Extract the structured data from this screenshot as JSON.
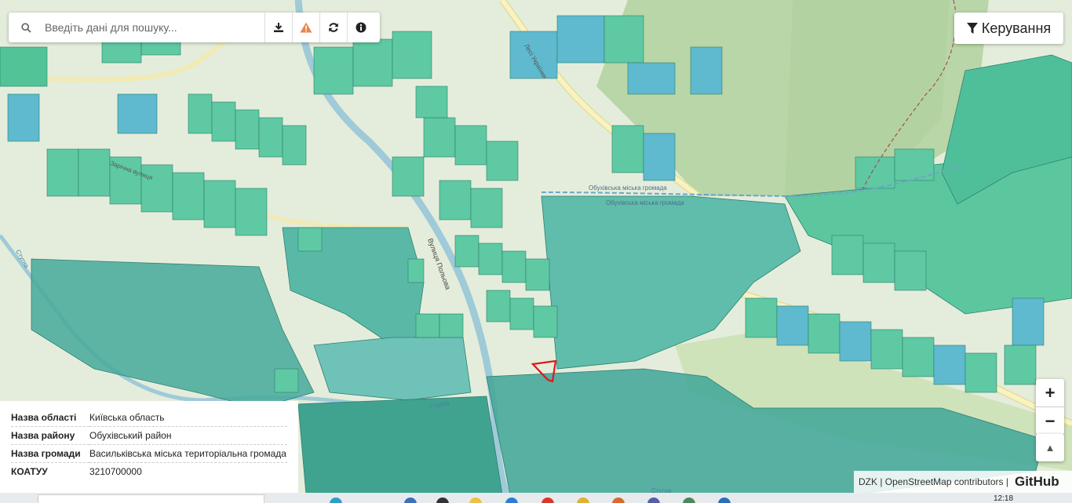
{
  "search": {
    "placeholder": "Введіть дані для пошуку..."
  },
  "toolbar": {
    "download_icon": "download-icon",
    "warning_icon": "warning-icon",
    "refresh_icon": "refresh-icon",
    "info_icon": "info-icon"
  },
  "manage_button": {
    "label": "Керування",
    "icon": "filter-icon"
  },
  "zoom": {
    "in_label": "+",
    "out_label": "−",
    "north_label": "▲"
  },
  "info_panel": {
    "rows": [
      {
        "key": "Назва області",
        "value": "Київська область"
      },
      {
        "key": "Назва району",
        "value": "Обухівський район"
      },
      {
        "key": "Назва громади",
        "value": "Васильківська міська територіальна громада"
      },
      {
        "key": "КОАТУУ",
        "value": "3210700000"
      }
    ]
  },
  "attribution": {
    "text": "DZK | OpenStreetMap contributors |",
    "github": "GitHub"
  },
  "map_labels": {
    "street1": "Лесі Українки",
    "street2": "Зарічна вулиця",
    "street3": "Вулиця Польова",
    "river1": "Стугна",
    "river2": "Стугна",
    "river3": "Стугна",
    "boundary1": "Обухівська міська громада",
    "boundary2": "Обухівська міська громада"
  },
  "taskbar": {
    "clock": "12:18"
  },
  "colors": {
    "parcel": "#5cc9a0",
    "parcel_dark": "#3ea88c",
    "parcel_blue": "#5aaed0",
    "forest": "#b8d9a8",
    "river": "#8ac5d8",
    "road": "#f6f1b8",
    "selected": "#e01818"
  }
}
